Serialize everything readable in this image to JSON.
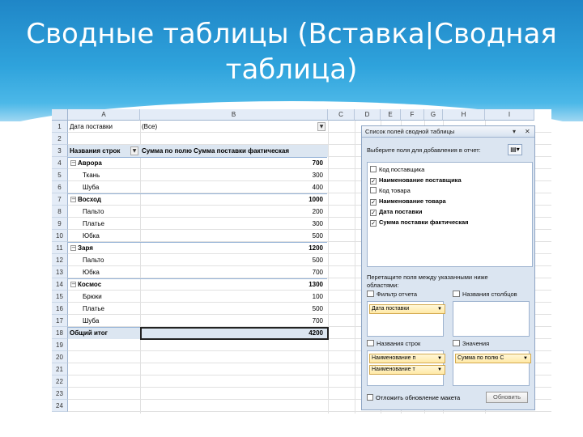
{
  "slide": {
    "title_line1": "Сводные таблицы (Вставка|Сводная",
    "title_line2": "таблица)"
  },
  "columns": [
    "A",
    "B",
    "C",
    "D",
    "E",
    "F",
    "G",
    "H",
    "I"
  ],
  "rows": [
    "1",
    "2",
    "3",
    "4",
    "5",
    "6",
    "7",
    "8",
    "9",
    "10",
    "11",
    "12",
    "13",
    "14",
    "15",
    "16",
    "17",
    "18",
    "19",
    "20",
    "21",
    "22",
    "23",
    "24"
  ],
  "pivot": {
    "filter_label": "Дата поставки",
    "filter_value": "(Все)",
    "row_header": "Названия строк",
    "value_header": "Сумма по полю Сумма поставки фактическая",
    "items": [
      {
        "label": "Аврора",
        "value": "700",
        "level": 0
      },
      {
        "label": "Ткань",
        "value": "300",
        "level": 1
      },
      {
        "label": "Шуба",
        "value": "400",
        "level": 1
      },
      {
        "label": "Восход",
        "value": "1000",
        "level": 0
      },
      {
        "label": "Пальто",
        "value": "200",
        "level": 1
      },
      {
        "label": "Платье",
        "value": "300",
        "level": 1
      },
      {
        "label": "Юбка",
        "value": "500",
        "level": 1
      },
      {
        "label": "Заря",
        "value": "1200",
        "level": 0
      },
      {
        "label": "Пальто",
        "value": "500",
        "level": 1
      },
      {
        "label": "Юбка",
        "value": "700",
        "level": 1
      },
      {
        "label": "Космос",
        "value": "1300",
        "level": 0
      },
      {
        "label": "Брюки",
        "value": "100",
        "level": 1
      },
      {
        "label": "Платье",
        "value": "500",
        "level": 1
      },
      {
        "label": "Шуба",
        "value": "700",
        "level": 1
      }
    ],
    "total_label": "Общий итог",
    "total_value": "4200"
  },
  "field_list": {
    "title": "Список полей сводной таблицы",
    "choose_label": "Выберите поля для добавления в отчет:",
    "fields": [
      {
        "label": "Код поставщика",
        "checked": false
      },
      {
        "label": "Наименование поставщика",
        "checked": true
      },
      {
        "label": "Код товара",
        "checked": false
      },
      {
        "label": "Наименование товара",
        "checked": true
      },
      {
        "label": "Дата поставки",
        "checked": true
      },
      {
        "label": "Сумма поставки фактическая",
        "checked": true
      }
    ],
    "drag_label_line1": "Перетащите поля между указанными ниже",
    "drag_label_line2": "областями:",
    "filter_area": "Фильтр отчета",
    "columns_area": "Названия столбцов",
    "rows_area": "Названия строк",
    "values_area": "Значения",
    "filter_chip": "Дата поставки",
    "row_chips": [
      "Наименование п",
      "Наименование т"
    ],
    "value_chip": "Сумма по полю С",
    "defer_label": "Отложить обновление макета",
    "update_button": "Обновить"
  }
}
